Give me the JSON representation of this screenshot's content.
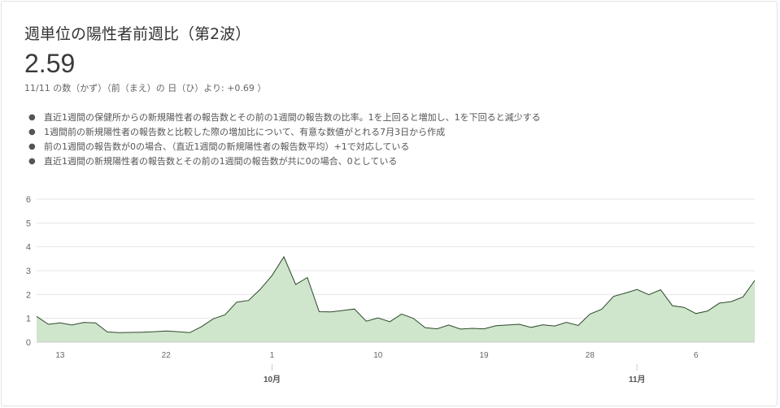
{
  "header": {
    "title": "週単位の陽性者前週比（第2波）",
    "value": "2.59",
    "comparison": "11/11 の数（かず）（前（まえ）の 日（ひ）より: +0.69 ）"
  },
  "notes": [
    "直近1週間の保健所からの新規陽性者の報告数とその前の1週間の報告数の比率。1を上回ると増加し、1を下回ると減少する",
    "1週間前の新規陽性者の報告数と比較した際の増加比について、有意な数値がとれる7月3日から作成",
    "前の1週間の報告数が0の場合、（直近1週間の新規陽性者の報告数平均）+1で対応している",
    "直近1週間の新規陽性者の報告数とその前の1週間の報告数が共に0の場合、0としている"
  ],
  "colors": {
    "area_fill": "#cfe5cc",
    "line": "#2d4a2a",
    "grid": "#e6e6e6",
    "axis_text": "#666666"
  },
  "chart_data": {
    "type": "area",
    "x_start": "2020-09-11",
    "x_end": "2020-11-11",
    "ylim": [
      0,
      6
    ],
    "yticks": [
      0,
      1,
      2,
      3,
      4,
      5,
      6
    ],
    "grid": true,
    "x_day_ticks": [
      {
        "date": "2020-09-13",
        "label": "13"
      },
      {
        "date": "2020-09-22",
        "label": "22"
      },
      {
        "date": "2020-10-01",
        "label": "1"
      },
      {
        "date": "2020-10-10",
        "label": "10"
      },
      {
        "date": "2020-10-19",
        "label": "19"
      },
      {
        "date": "2020-10-28",
        "label": "28"
      },
      {
        "date": "2020-11-06",
        "label": "6"
      }
    ],
    "x_month_ticks": [
      {
        "date": "2020-10-01",
        "label": "10月"
      },
      {
        "date": "2020-11-01",
        "label": "11月"
      }
    ],
    "series": [
      {
        "values": [
          1.08,
          0.75,
          0.81,
          0.72,
          0.83,
          0.81,
          0.43,
          0.4,
          0.41,
          0.42,
          0.44,
          0.47,
          0.44,
          0.4,
          0.65,
          0.98,
          1.15,
          1.68,
          1.75,
          2.22,
          2.8,
          3.58,
          2.42,
          2.71,
          1.28,
          1.27,
          1.33,
          1.39,
          0.88,
          1.02,
          0.86,
          1.18,
          1.0,
          0.61,
          0.56,
          0.72,
          0.55,
          0.58,
          0.56,
          0.69,
          0.72,
          0.75,
          0.62,
          0.73,
          0.68,
          0.83,
          0.7,
          1.18,
          1.38,
          1.92,
          2.06,
          2.21,
          1.99,
          2.2,
          1.53,
          1.46,
          1.2,
          1.31,
          1.64,
          1.7,
          1.9,
          2.59
        ]
      }
    ]
  }
}
